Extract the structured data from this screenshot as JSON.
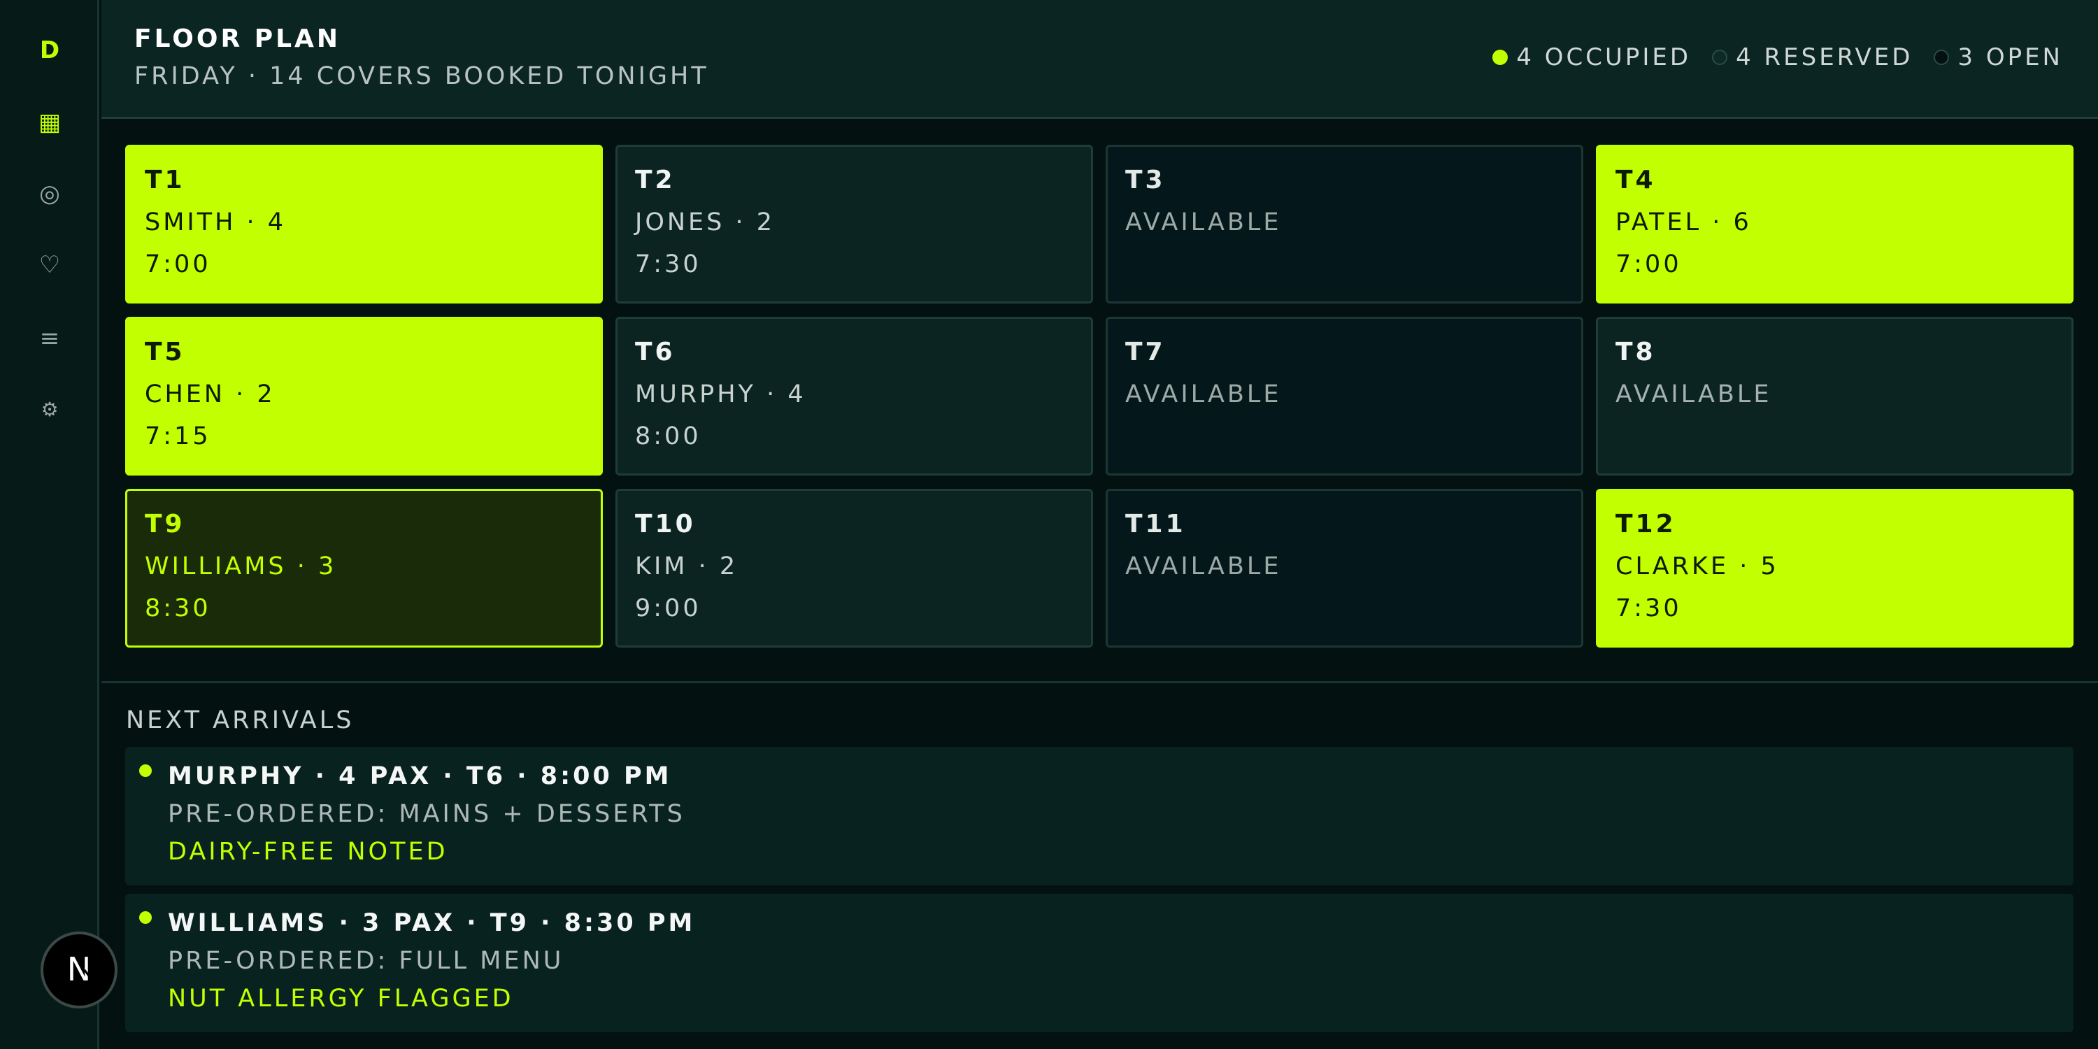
{
  "sidebar": {
    "brand": "D",
    "items": [
      {
        "name": "grid",
        "icon": "▦",
        "active": true
      },
      {
        "name": "target",
        "icon": "◎",
        "active": false
      },
      {
        "name": "heart",
        "icon": "♡",
        "active": false
      },
      {
        "name": "menu",
        "icon": "≡",
        "active": false
      },
      {
        "name": "settings",
        "icon": "⚙",
        "active": false
      }
    ],
    "avatar_letter": "N"
  },
  "header": {
    "title": "FLOOR PLAN",
    "subtitle": "FRIDAY · 14 COVERS BOOKED TONIGHT",
    "legend": {
      "occupied": "4 OCCUPIED",
      "reserved": "4 RESERVED",
      "open": "3 OPEN"
    }
  },
  "tables": [
    {
      "id": "T1",
      "name": "SMITH · 4",
      "time": "7:00",
      "status": "occupied"
    },
    {
      "id": "T2",
      "name": "JONES · 2",
      "time": "7:30",
      "status": "reserved"
    },
    {
      "id": "T3",
      "name": "AVAILABLE",
      "time": "",
      "status": "open"
    },
    {
      "id": "T4",
      "name": "PATEL · 6",
      "time": "7:00",
      "status": "occupied"
    },
    {
      "id": "T5",
      "name": "CHEN · 2",
      "time": "7:15",
      "status": "occupied"
    },
    {
      "id": "T6",
      "name": "MURPHY · 4",
      "time": "8:00",
      "status": "reserved"
    },
    {
      "id": "T7",
      "name": "AVAILABLE",
      "time": "",
      "status": "open"
    },
    {
      "id": "T8",
      "name": "AVAILABLE",
      "time": "",
      "status": "open"
    },
    {
      "id": "T9",
      "name": "WILLIAMS · 3",
      "time": "8:30",
      "status": "arriving"
    },
    {
      "id": "T10",
      "name": "KIM · 2",
      "time": "9:00",
      "status": "reserved"
    },
    {
      "id": "T11",
      "name": "AVAILABLE",
      "time": "",
      "status": "open"
    },
    {
      "id": "T12",
      "name": "CLARKE · 5",
      "time": "7:30",
      "status": "occupied"
    }
  ],
  "arrivals": {
    "title": "NEXT ARRIVALS",
    "items": [
      {
        "line1": "MURPHY · 4 PAX · T6 · 8:00 PM",
        "line2": "PRE-ORDERED: MAINS + DESSERTS",
        "line3": "DAIRY-FREE NOTED"
      },
      {
        "line1": "WILLIAMS · 3 PAX · T9 · 8:30 PM",
        "line2": "PRE-ORDERED: FULL MENU",
        "line3": "NUT ALLERGY FLAGGED"
      }
    ]
  },
  "colors": {
    "accent": "#c2ff00",
    "background": "#031211",
    "panel": "#0a2522"
  }
}
